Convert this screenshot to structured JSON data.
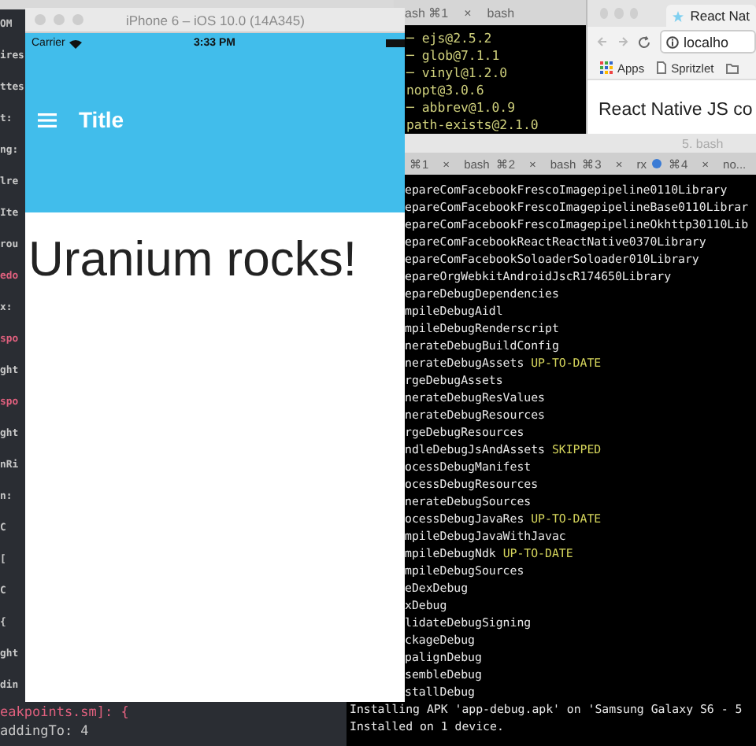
{
  "editor": {
    "lines": [
      {
        "text": "OM",
        "color": "#c8c8c8"
      },
      {
        "text": "ires",
        "color": "#c8c8c8"
      },
      {
        "text": "ttes",
        "color": "#c8c8c8"
      },
      {
        "text": "t:",
        "color": "#c8c8c8"
      },
      {
        "text": "ng:",
        "color": "#c8c8c8"
      },
      {
        "text": "lre",
        "color": "#c8c8c8"
      },
      {
        "text": "Ite",
        "color": "#c8c8c8"
      },
      {
        "text": "rou",
        "color": "#c8c8c8"
      },
      {
        "text": "edo",
        "color": "#e0607e"
      },
      {
        "text": "x:",
        "color": "#c8c8c8"
      },
      {
        "text": "spo",
        "color": "#e0607e"
      },
      {
        "text": "ght",
        "color": "#c8c8c8"
      },
      {
        "text": "spo",
        "color": "#e0607e"
      },
      {
        "text": "ght",
        "color": "#c8c8c8"
      },
      {
        "text": "nRi",
        "color": "#c8c8c8"
      },
      {
        "text": "n:",
        "color": "#c8c8c8"
      },
      {
        "text": "C",
        "color": "#c8c8c8"
      },
      {
        "text": "[",
        "color": "#c8c8c8"
      },
      {
        "text": "C",
        "color": "#c8c8c8"
      },
      {
        "text": "{",
        "color": "#c8c8c8"
      },
      {
        "text": "ght",
        "color": "#c8c8c8"
      },
      {
        "text": "din",
        "color": "#c8c8c8"
      }
    ],
    "bottom_lines": [
      {
        "text": "eakpoints.sm]: {",
        "color": "#e0607e"
      },
      {
        "text": "addingTo: 4",
        "color": "#c8c8c8"
      }
    ]
  },
  "phone": {
    "window_title": "iPhone 6 – iOS 10.0 (14A345)",
    "carrier": "Carrier",
    "time": "3:33 PM",
    "nav_title": "Title",
    "body_text": "Uranium rocks!"
  },
  "back_terminal": {
    "tabs": [
      {
        "title": "ash",
        "shortcut": "⌘1"
      },
      {
        "close": "×",
        "title": "bash"
      }
    ],
    "lines": [
      "─ ejs@2.5.2",
      "─ glob@7.1.1",
      "─ vinyl@1.2.0",
      "nopt@3.0.6",
      "─ abbrev@1.0.9",
      "path-exists@2.1.0"
    ]
  },
  "browser": {
    "tab_title": "React Nat",
    "address": "localho",
    "bookmarks": [
      {
        "kind": "apps",
        "label": "Apps"
      },
      {
        "kind": "page",
        "label": "Spritzlet"
      },
      {
        "kind": "folder"
      }
    ],
    "heading": "React Native JS co"
  },
  "front_terminal": {
    "title": "5. bash",
    "tabs": [
      {
        "shortcut": "⌘1",
        "busy": false
      },
      {
        "close": "×",
        "title": "bash",
        "shortcut": "⌘2",
        "busy": false
      },
      {
        "close": "×",
        "title": "bash",
        "shortcut": "⌘3",
        "busy": false
      },
      {
        "close": "×",
        "title": "rx",
        "shortcut": "⌘4",
        "busy": true
      },
      {
        "close": "×",
        "title": "no...",
        "busy": false
      }
    ],
    "lines": [
      {
        "text": "epareComFacebookFrescoImagepipeline0110Library",
        "cut": true
      },
      {
        "text": "epareComFacebookFrescoImagepipelineBase0110Librar",
        "cut": true
      },
      {
        "text": "epareComFacebookFrescoImagepipelineOkhttp30110Lib",
        "cut": true
      },
      {
        "text": "epareComFacebookReactReactNative0370Library",
        "cut": true
      },
      {
        "text": "epareComFacebookSoloaderSoloader010Library",
        "cut": true
      },
      {
        "text": "epareOrgWebkitAndroidJscR174650Library",
        "cut": true
      },
      {
        "text": "epareDebugDependencies",
        "cut": true
      },
      {
        "text": "mpileDebugAidl",
        "cut": true
      },
      {
        "text": "mpileDebugRenderscript",
        "cut": true
      },
      {
        "text": "nerateDebugBuildConfig",
        "cut": true
      },
      {
        "text": "nerateDebugAssets",
        "status": "UP-TO-DATE",
        "cut": true
      },
      {
        "text": "rgeDebugAssets",
        "cut": true
      },
      {
        "text": "nerateDebugResValues",
        "cut": true
      },
      {
        "text": "nerateDebugResources",
        "cut": true
      },
      {
        "text": "rgeDebugResources",
        "cut": true
      },
      {
        "text": "ndleDebugJsAndAssets",
        "status": "SKIPPED",
        "cut": true
      },
      {
        "text": "ocessDebugManifest",
        "cut": true
      },
      {
        "text": "ocessDebugResources",
        "cut": true
      },
      {
        "text": "nerateDebugSources",
        "cut": true
      },
      {
        "text": "ocessDebugJavaRes",
        "status": "UP-TO-DATE",
        "cut": true
      },
      {
        "text": "mpileDebugJavaWithJavac",
        "cut": true
      },
      {
        "text": "mpileDebugNdk",
        "status": "UP-TO-DATE",
        "cut": true
      },
      {
        "text": "mpileDebugSources",
        "cut": true
      },
      {
        "text": "eDexDebug",
        "cut": true
      },
      {
        "text": "xDebug",
        "cut": true
      },
      {
        "text": "lidateDebugSigning",
        "cut": true
      },
      {
        "text": "ckageDebug",
        "cut": true
      },
      {
        "text": "palignDebug",
        "cut": true
      },
      {
        "text": "sembleDebug",
        "cut": true
      },
      {
        "text": "stallDebug",
        "cut": true
      },
      {
        "text": "Installing APK 'app-debug.apk' on 'Samsung Galaxy S6 - 5",
        "cut": false
      },
      {
        "text": "Installed on 1 device.",
        "cut": false
      }
    ]
  }
}
